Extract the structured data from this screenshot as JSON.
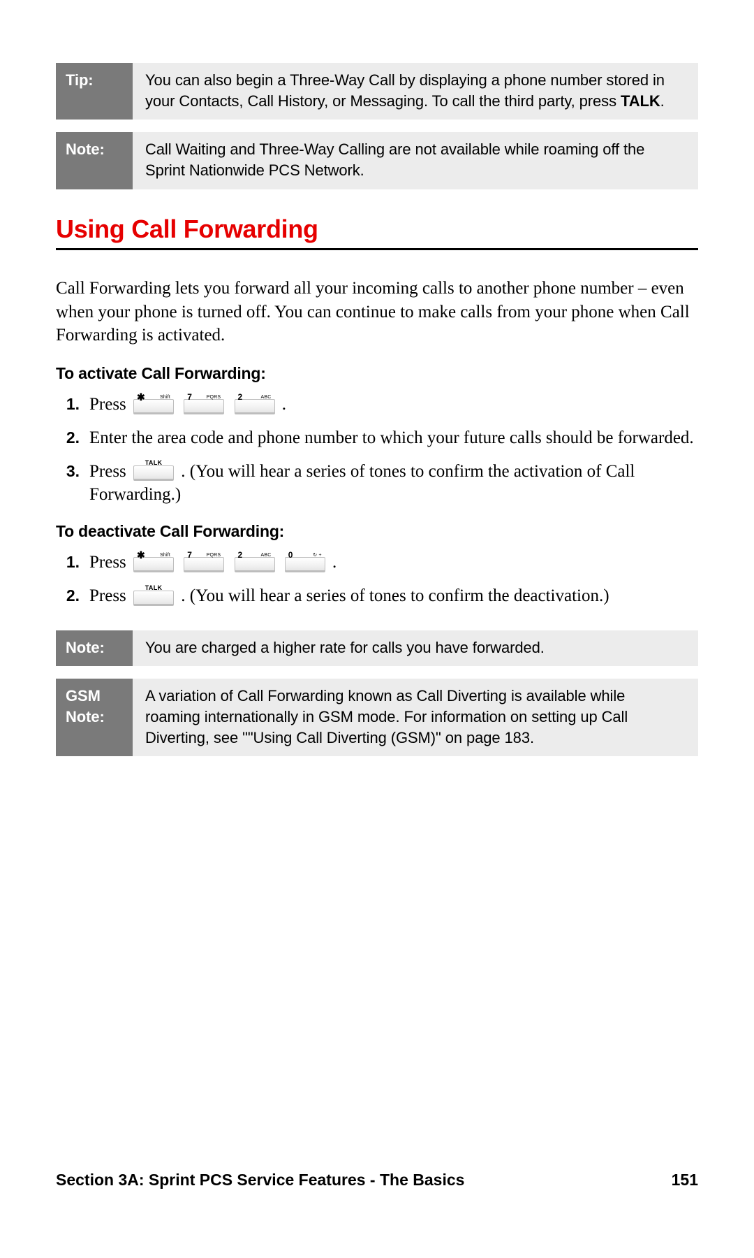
{
  "callouts": {
    "tip": {
      "tag": "Tip:",
      "text_pre": "You can also begin a Three-Way Call by displaying a phone number stored in your Contacts, Call History, or Messaging. To call the third party, press ",
      "bold": "TALK",
      "text_post": "."
    },
    "note1": {
      "tag": "Note:",
      "text": "Call Waiting and Three-Way Calling are not available while roaming off the Sprint Nationwide PCS Network."
    },
    "note2": {
      "tag": "Note:",
      "text": "You are charged a higher rate for calls you have forwarded."
    },
    "gsm": {
      "tag": "GSM Note:",
      "text": "A variation of Call Forwarding known as Call Diverting is available while roaming internationally in GSM mode. For information on setting up Call Diverting, see \"\"Using Call Diverting (GSM)\" on page 183."
    }
  },
  "heading": "Using Call Forwarding",
  "intro": "Call Forwarding lets you forward all your incoming calls to another phone number – even when your phone is turned off. You can continue to make calls from your phone when Call Forwarding is activated.",
  "activate": {
    "title": "To activate Call Forwarding:",
    "steps": {
      "s1": {
        "num": "1.",
        "pre": "Press ",
        "post": "."
      },
      "s2": {
        "num": "2.",
        "text": "Enter the area code and phone number to which your future calls should be forwarded."
      },
      "s3": {
        "num": "3.",
        "pre": "Press ",
        "post": ". (You will hear a series of tones to confirm the activation of Call Forwarding.)"
      }
    }
  },
  "deactivate": {
    "title": "To deactivate Call Forwarding:",
    "steps": {
      "s1": {
        "num": "1.",
        "pre": "Press ",
        "post": "."
      },
      "s2": {
        "num": "2.",
        "pre": "Press ",
        "post": ". (You will hear a series of tones to confirm the deactivation.)"
      }
    }
  },
  "keys": {
    "star": {
      "main": "✱",
      "sub": "Shift"
    },
    "seven": {
      "main": "7",
      "sub": "PQRS"
    },
    "two": {
      "main": "2",
      "sub": "ABC"
    },
    "zero": {
      "main": "0",
      "sub": "↻ +"
    },
    "talk": {
      "label": "TALK"
    }
  },
  "footer": {
    "section": "Section 3A: Sprint PCS Service Features - The Basics",
    "page": "151"
  }
}
